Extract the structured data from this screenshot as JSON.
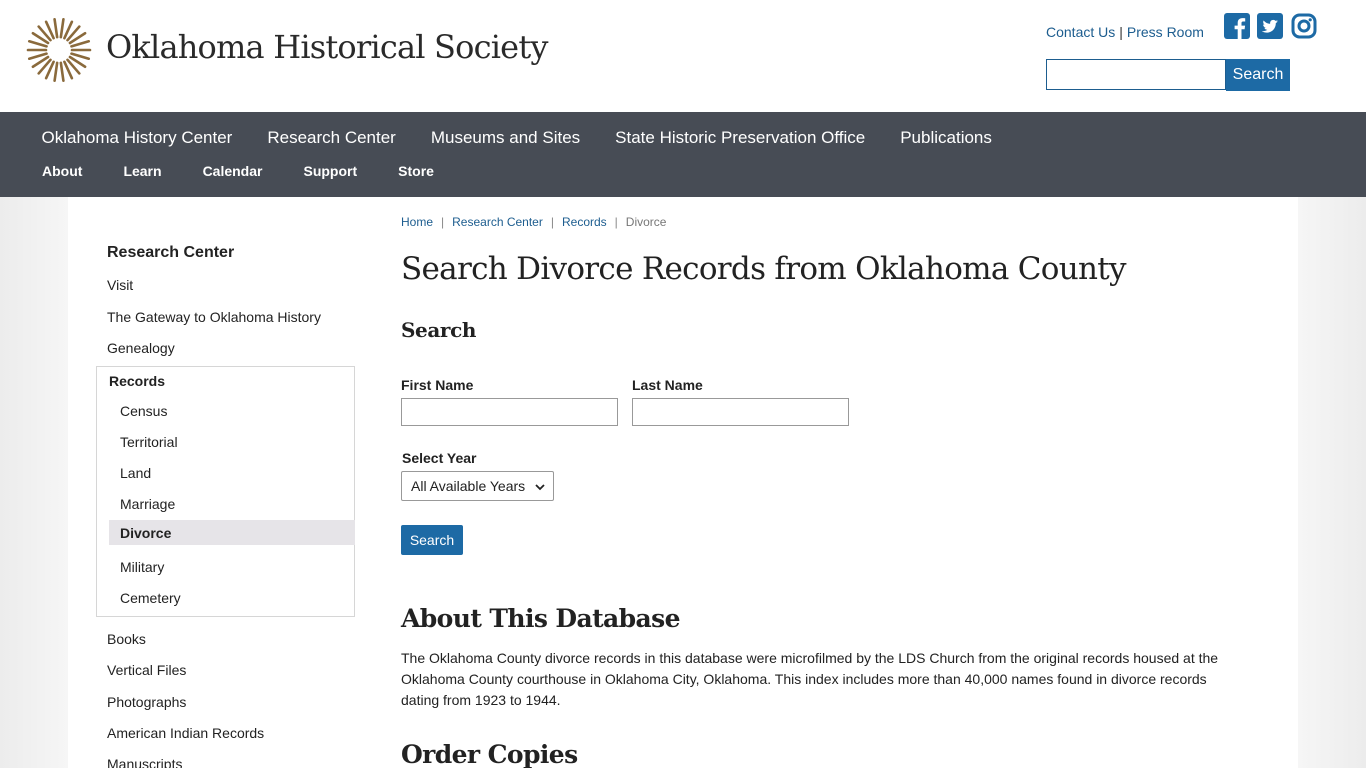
{
  "header": {
    "site_name": "Oklahoma Historical Society",
    "contact_link": "Contact Us",
    "separator": "|",
    "press_link": "Press Room",
    "search_button": "Search",
    "social_icons": [
      "facebook-icon",
      "twitter-icon",
      "instagram-icon"
    ],
    "brand_color": "#8a6a3c"
  },
  "nav": {
    "primary": [
      {
        "label": "Oklahoma History Center"
      },
      {
        "label": "Research Center"
      },
      {
        "label": "Museums and Sites"
      },
      {
        "label": "State Historic Preservation Office"
      },
      {
        "label": "Publications"
      }
    ],
    "secondary": [
      {
        "label": "About"
      },
      {
        "label": "Learn"
      },
      {
        "label": "Calendar"
      },
      {
        "label": "Support"
      },
      {
        "label": "Store"
      }
    ],
    "background": "#474c55"
  },
  "sidebar": {
    "title": "Research Center",
    "links_top": [
      "Visit",
      "The Gateway to Oklahoma History",
      "Genealogy"
    ],
    "records": {
      "title": "Records",
      "items": [
        "Census",
        "Territorial",
        "Land",
        "Marriage",
        "Divorce",
        "Military",
        "Cemetery"
      ],
      "active": "Divorce"
    },
    "links_bottom": [
      "Books",
      "Vertical Files",
      "Photographs",
      "American Indian Records",
      "Manuscripts"
    ]
  },
  "breadcrumb": {
    "items": [
      "Home",
      "Research Center",
      "Records"
    ],
    "current": "Divorce",
    "separator": "|"
  },
  "main": {
    "title": "Search Divorce Records from Oklahoma County",
    "search_heading": "Search",
    "first_name_label": "First Name",
    "last_name_label": "Last Name",
    "first_name_value": "",
    "last_name_value": "",
    "select_year_label": "Select Year",
    "select_year_value": "All Available Years",
    "search_button": "Search",
    "about_heading": "About This Database",
    "about_text": "The Oklahoma County divorce records in this database were microfilmed by the LDS Church from the original records housed at the Oklahoma County courthouse in Oklahoma City, Oklahoma. This index includes more than 40,000 names found in divorce records dating from 1923 to 1944.",
    "order_heading": "Order Copies"
  },
  "colors": {
    "link": "#1d5d8f",
    "button": "#1d6aa5",
    "active_item_bg": "#e6e4e8"
  }
}
